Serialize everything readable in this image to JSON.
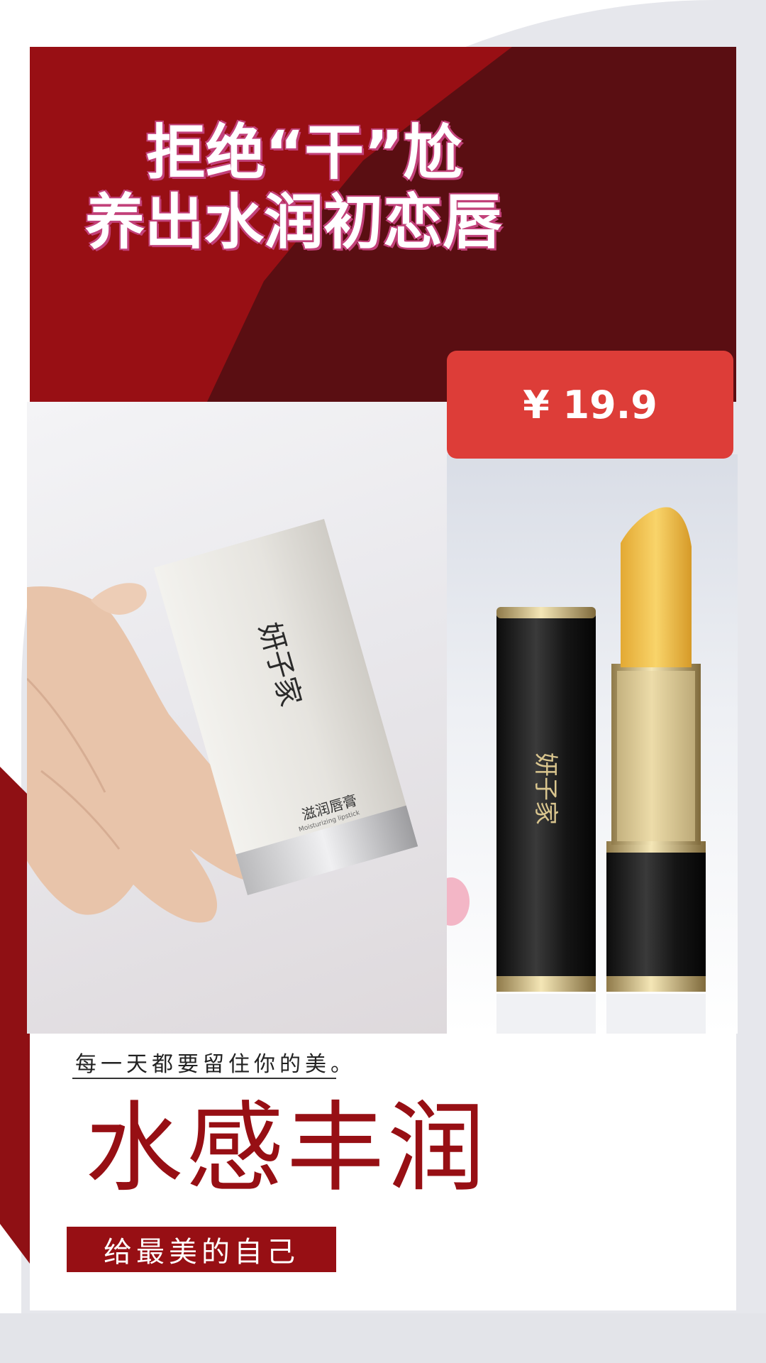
{
  "header": {
    "headline_line1": "拒绝“干”尬",
    "headline_line2": "养出水润初恋唇"
  },
  "price": {
    "label": "¥ 19.9"
  },
  "products": {
    "box_label": "滋润唇膏",
    "box_sublabel": "Moisturizing lipstick",
    "brand_mark": "妍子家"
  },
  "footer": {
    "tagline": "每一天都要留住你的美。",
    "title": "水感丰润",
    "subtitle": "给最美的自己"
  },
  "colors": {
    "brand_red": "#970f14",
    "dark_red": "#5a0e12",
    "price_red": "#dd3d38",
    "background_grey": "#e6e7ec"
  },
  "icons": [
    "hand-holding-box-image",
    "lipstick-image"
  ]
}
